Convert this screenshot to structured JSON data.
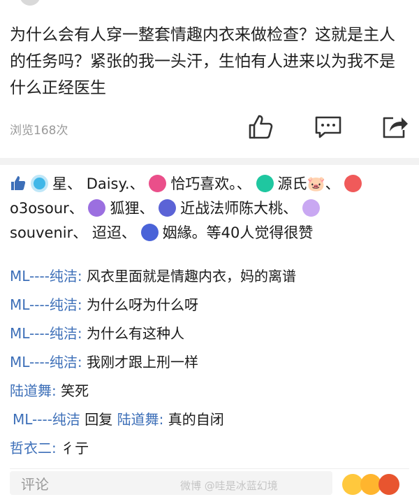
{
  "post": {
    "text": "为什么会有人穿一整套情趣内衣来做检查？这就是主人的任务吗？紧张的我一头汗，生怕有人进来以为我不是什么正经医生",
    "views": "浏览168次"
  },
  "likes": {
    "names": [
      "星、",
      "Daisy.、",
      "恰巧喜欢。、",
      "源氏🐷、",
      "o3osour、",
      "狐狸、",
      "近战法师陈大桃、",
      "souvenir、",
      "迢迢、",
      "姻緣。"
    ],
    "summary": "等40人觉得很赞",
    "colors": {
      "thumb": "#3d6fb8",
      "icon1": "#3fb7e8",
      "icon2": "#ea4f8a",
      "icon3": "#1fc7a0",
      "icon4": "#f05a5a",
      "icon5": "#9b6fe0",
      "icon6": "#5b63d6",
      "icon7": "#c9a8f2",
      "icon8": "#4a63d8"
    }
  },
  "comments": [
    {
      "author": "ML----纯洁:",
      "text": " 风衣里面就是情趣内衣，妈的离谱"
    },
    {
      "author": "ML----纯洁:",
      "text": " 为什么呀为什么呀"
    },
    {
      "author": "ML----纯洁:",
      "text": " 为什么有这种人"
    },
    {
      "author": "ML----纯洁:",
      "text": " 我刚才跟上刑一样"
    },
    {
      "author": "陆道舞:",
      "text": " 笑死"
    },
    {
      "author": "ML----纯洁",
      "reply_word": " 回复 ",
      "reply_to": "陆道舞:",
      "text": " 真的自闭"
    },
    {
      "author": "哲衣二:",
      "text": " 彳亍"
    }
  ],
  "footer": {
    "comment_placeholder": "评论",
    "watermark": "微博 @哇是冰蓝幻境"
  },
  "icons": [
    "thumb-up-icon",
    "chat-bubble-icon",
    "share-icon",
    "emoji-icon"
  ]
}
